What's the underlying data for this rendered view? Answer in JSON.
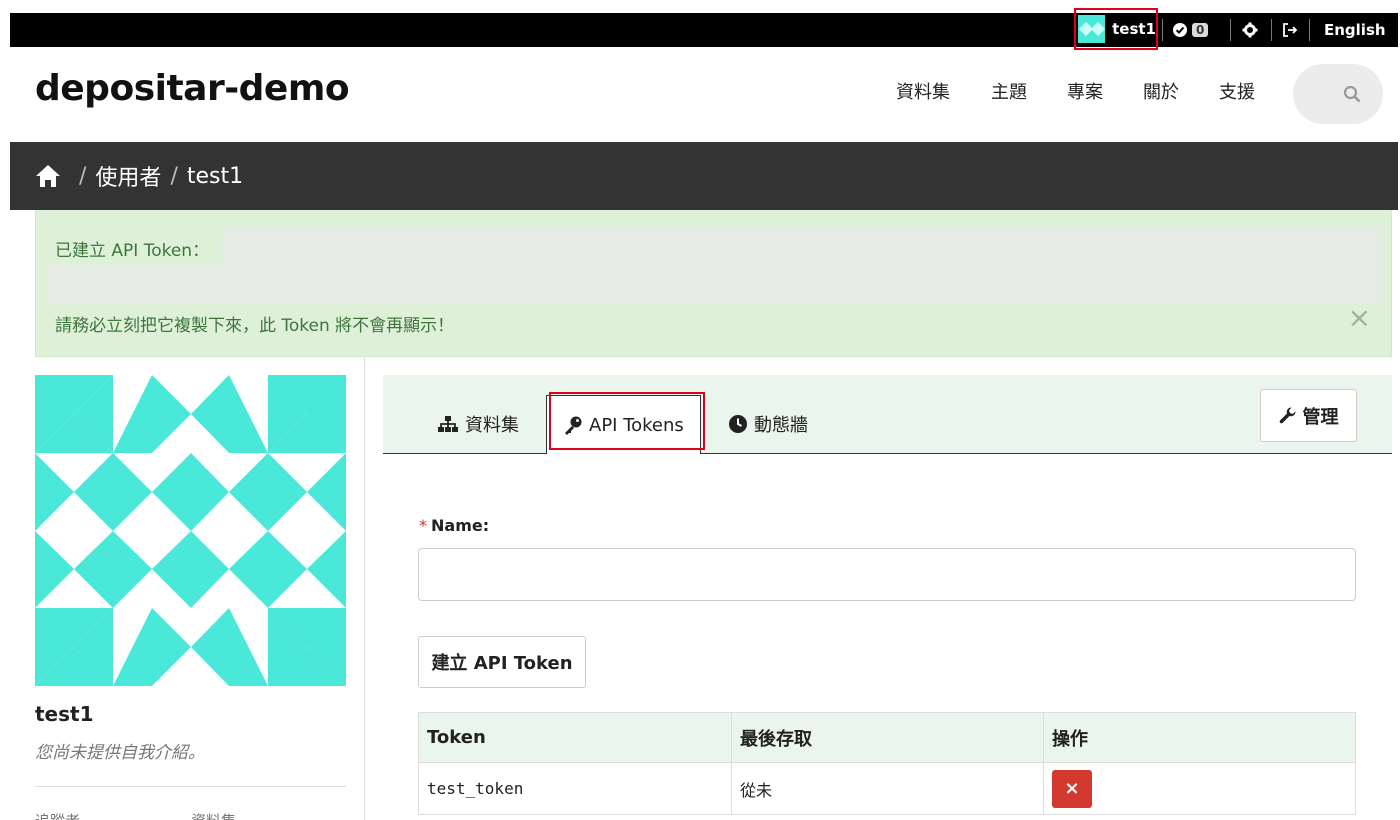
{
  "account": {
    "username": "test1",
    "notifications_count": "0",
    "language": "English"
  },
  "site": {
    "title": "depositar-demo"
  },
  "nav": {
    "items": [
      "資料集",
      "主題",
      "專案",
      "關於",
      "支援"
    ]
  },
  "breadcrumb": {
    "items": [
      "使用者",
      "test1"
    ]
  },
  "alert": {
    "line1": "已建立 API Token：",
    "line2": "請務必立刻把它複製下來，此 Token 將不會再顯示！",
    "close": "×"
  },
  "profile": {
    "name": "test1",
    "bio": "您尚未提供自我介紹。",
    "stats": [
      "追蹤者",
      "資料集"
    ]
  },
  "tabs": {
    "datasets": "資料集",
    "api_tokens": "API Tokens",
    "activity": "動態牆"
  },
  "manage_button": "管理",
  "form": {
    "required_marker": "*",
    "name_label": "Name:",
    "name_value": "",
    "create_button": "建立 API Token"
  },
  "table": {
    "headers": [
      "Token",
      "最後存取",
      "操作"
    ],
    "rows": [
      {
        "token": "test_token",
        "last_access": "從未",
        "action": "×"
      }
    ]
  },
  "colors": {
    "accent": "#4ae8d8",
    "highlight": "#e0001b",
    "danger": "#d33a2f",
    "alert_bg": "#dff0d8"
  }
}
